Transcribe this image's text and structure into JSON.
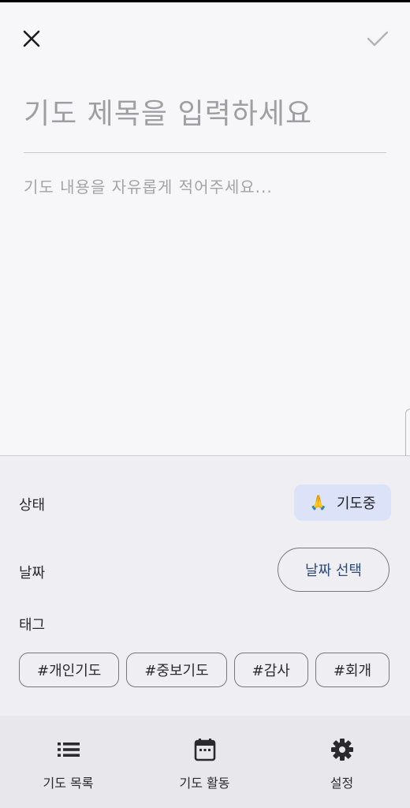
{
  "header": {
    "close_icon": "close-icon",
    "confirm_icon": "check-icon"
  },
  "editor": {
    "title_placeholder": "기도 제목을 입력하세요",
    "content_placeholder": "기도 내용을 자유롭게 적어주세요..."
  },
  "form": {
    "status_label": "상태",
    "status_value": "기도중",
    "status_emoji": "🙏",
    "date_label": "날짜",
    "date_button": "날짜 선택",
    "tags_label": "태그",
    "tags": [
      "#개인기도",
      "#중보기도",
      "#감사",
      "#회개"
    ]
  },
  "bottom_nav": {
    "items": [
      {
        "label": "기도 목록",
        "icon": "list-icon"
      },
      {
        "label": "기도 활동",
        "icon": "calendar-icon"
      },
      {
        "label": "설정",
        "icon": "gear-icon"
      }
    ]
  },
  "colors": {
    "background": "#f7f6f9",
    "panel": "#efeef2",
    "status_chip": "#dce3f8",
    "date_text": "#2f4a7a",
    "nav_background": "#e8e7ec"
  }
}
